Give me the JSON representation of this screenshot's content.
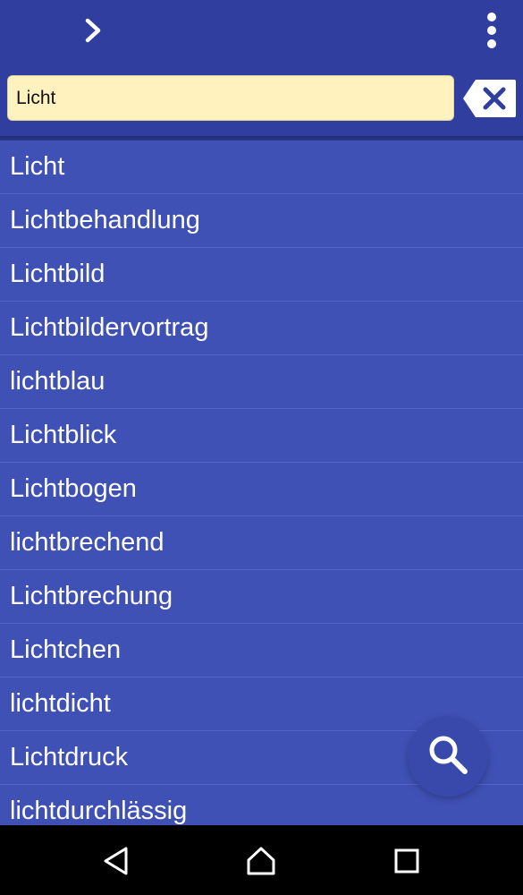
{
  "toolbar": {
    "forward_icon": "chevron-right-icon",
    "menu_icon": "more-vert-icon"
  },
  "search": {
    "value": "Licht",
    "clear_icon": "backspace-clear-icon"
  },
  "results": [
    "Licht",
    "Lichtbehandlung",
    "Lichtbild",
    "Lichtbildervortrag",
    "lichtblau",
    "Lichtblick",
    "Lichtbogen",
    "lichtbrechend",
    "Lichtbrechung",
    "Lichtchen",
    "lichtdicht",
    "Lichtdruck",
    "lichtdurchlässig"
  ],
  "fab": {
    "icon": "search-icon"
  },
  "navigation": {
    "back_icon": "back-icon",
    "home_icon": "home-icon",
    "recents_icon": "recents-icon"
  },
  "colors": {
    "toolbar": "#303f9f",
    "list_background": "#3f51b5",
    "search_field": "#fff2bf",
    "text": "#ffffff"
  }
}
